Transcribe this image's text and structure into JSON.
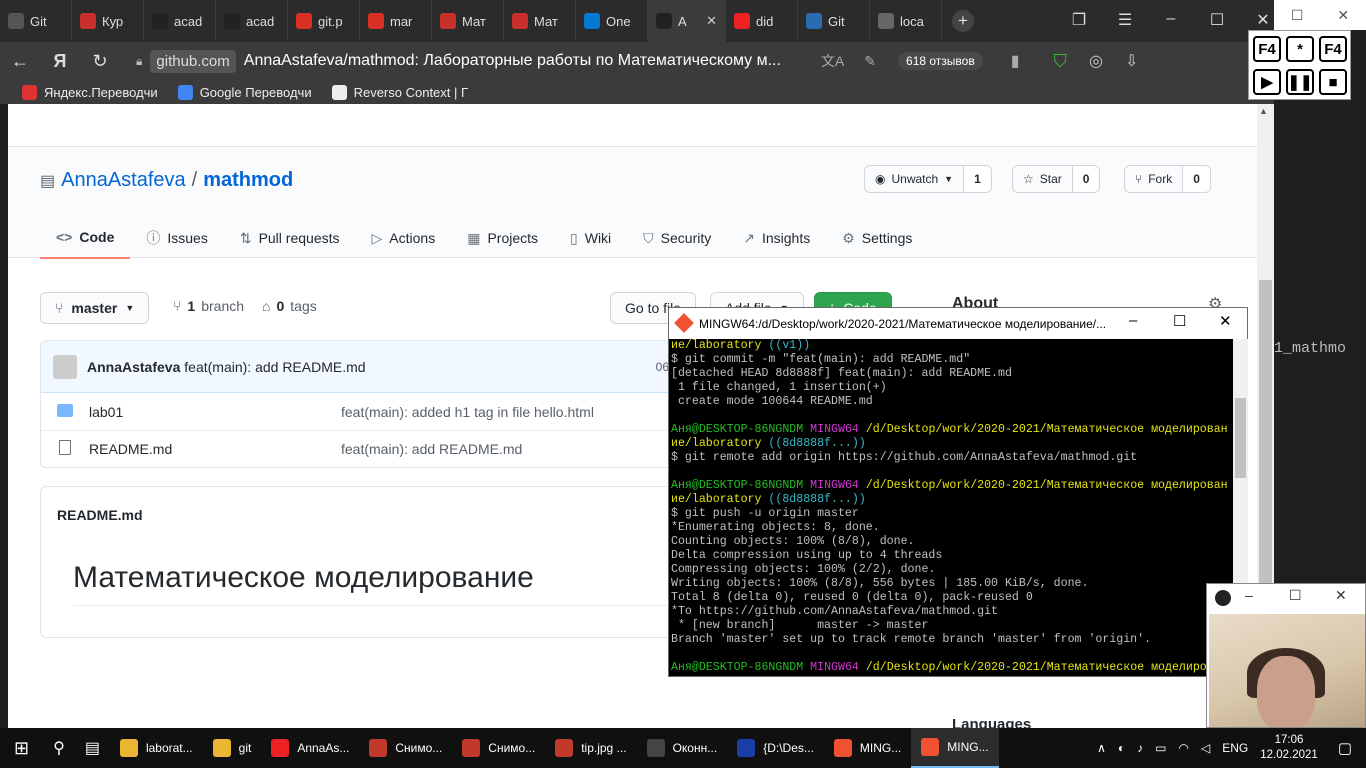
{
  "browser": {
    "tabs": [
      {
        "label": "Git",
        "icon": "bookmark-icon",
        "color": "#555"
      },
      {
        "label": "Кур",
        "icon": "course-icon",
        "color": "#c9302c"
      },
      {
        "label": "acad",
        "icon": "github-icon",
        "color": "#222"
      },
      {
        "label": "acad",
        "icon": "github-icon",
        "color": "#222"
      },
      {
        "label": "git.p",
        "icon": "pdf-icon",
        "color": "#d93025"
      },
      {
        "label": "mar",
        "icon": "pdf-icon",
        "color": "#d93025"
      },
      {
        "label": "Мат",
        "icon": "course-icon",
        "color": "#c9302c"
      },
      {
        "label": "Мат",
        "icon": "course-icon",
        "color": "#c9302c"
      },
      {
        "label": "One",
        "icon": "onedrive-icon",
        "color": "#0078d4"
      },
      {
        "label": "A",
        "icon": "github-icon",
        "color": "#222",
        "active": true
      },
      {
        "label": "did",
        "icon": "yandex-icon",
        "color": "#e22"
      },
      {
        "label": "Git",
        "icon": "git-icon",
        "color": "#2b6cb0"
      },
      {
        "label": "loca",
        "icon": "page-icon",
        "color": "#666"
      }
    ],
    "domain": "github.com",
    "page_title": "AnnaAstafeva/mathmod: Лабораторные работы по Математическому м...",
    "reviews": "618 отзывов",
    "bookmarks": [
      {
        "label": "Яндекс.Переводчи",
        "color": "#d33"
      },
      {
        "label": "Google Переводчи",
        "color": "#4285f4"
      },
      {
        "label": "Reverso Context | Г",
        "color": "#eee"
      }
    ]
  },
  "repo": {
    "owner": "AnnaAstafeva",
    "separator": "/",
    "name": "mathmod",
    "watch_label": "Unwatch",
    "watch_count": "1",
    "star_label": "Star",
    "star_count": "0",
    "fork_label": "Fork",
    "fork_count": "0",
    "nav": [
      {
        "label": "Code",
        "icon": "code-icon",
        "glyph": "<>"
      },
      {
        "label": "Issues",
        "icon": "issues-icon",
        "glyph": "ⓘ"
      },
      {
        "label": "Pull requests",
        "icon": "pull-request-icon",
        "glyph": "⇅"
      },
      {
        "label": "Actions",
        "icon": "play-icon",
        "glyph": "▷"
      },
      {
        "label": "Projects",
        "icon": "projects-icon",
        "glyph": "▦"
      },
      {
        "label": "Wiki",
        "icon": "book-icon",
        "glyph": "▯"
      },
      {
        "label": "Security",
        "icon": "shield-icon",
        "glyph": "⛉"
      },
      {
        "label": "Insights",
        "icon": "graph-icon",
        "glyph": "↗"
      },
      {
        "label": "Settings",
        "icon": "gear-icon",
        "glyph": "⚙"
      }
    ],
    "branch": "master",
    "branch_count": "1",
    "branch_word": "branch",
    "tag_count": "0",
    "tag_word": "tags",
    "goto_file": "Go to file",
    "add_file": "Add file",
    "code_label": "Code",
    "about": "About",
    "commit": {
      "author": "AnnaAstafeva",
      "message": "feat(main): add README.md",
      "hash": "06"
    },
    "files": [
      {
        "name": "lab01",
        "type": "folder",
        "message": "feat(main): added h1 tag in file hello.html"
      },
      {
        "name": "README.md",
        "type": "file",
        "message": "feat(main): add README.md"
      }
    ],
    "readme_label": "README.md",
    "readme_heading": "Математическое моделирование",
    "languages": "Languages"
  },
  "right_panel_text": "1_mathmo",
  "keys": [
    "F4",
    "*",
    "F4",
    "▶",
    "❚❚",
    "■"
  ],
  "terminal": {
    "title": "MINGW64:/d/Desktop/work/2020-2021/Математическое моделирование/...",
    "lines": [
      [
        {
          "t": "ие/laboratory ",
          "c": "c-y"
        },
        {
          "t": "((v1))",
          "c": "c-c"
        }
      ],
      [
        {
          "t": "$ git commit -m \"feat(main): add README.md\"",
          "c": ""
        }
      ],
      [
        {
          "t": "[detached HEAD 8d8888f] feat(main): add README.md",
          "c": ""
        }
      ],
      [
        {
          "t": " 1 file changed, 1 insertion(+)",
          "c": ""
        }
      ],
      [
        {
          "t": " create mode 100644 README.md",
          "c": ""
        }
      ],
      [
        {
          "t": "",
          "c": ""
        }
      ],
      [
        {
          "t": "Аня@DESKTOP-86NGNDM ",
          "c": "c-g"
        },
        {
          "t": "MINGW64 ",
          "c": "c-m"
        },
        {
          "t": "/d/Desktop/work/2020-2021/Математическое моделирован",
          "c": "c-y"
        }
      ],
      [
        {
          "t": "ие/laboratory ",
          "c": "c-y"
        },
        {
          "t": "((8d8888f...))",
          "c": "c-c"
        }
      ],
      [
        {
          "t": "$ git remote add origin https://github.com/AnnaAstafeva/mathmod.git",
          "c": ""
        }
      ],
      [
        {
          "t": "",
          "c": ""
        }
      ],
      [
        {
          "t": "Аня@DESKTOP-86NGNDM ",
          "c": "c-g"
        },
        {
          "t": "MINGW64 ",
          "c": "c-m"
        },
        {
          "t": "/d/Desktop/work/2020-2021/Математическое моделирован",
          "c": "c-y"
        }
      ],
      [
        {
          "t": "ие/laboratory ",
          "c": "c-y"
        },
        {
          "t": "((8d8888f...))",
          "c": "c-c"
        }
      ],
      [
        {
          "t": "$ git push -u origin master",
          "c": ""
        }
      ],
      [
        {
          "t": "*Enumerating objects: 8, done.",
          "c": ""
        }
      ],
      [
        {
          "t": "Counting objects: 100% (8/8), done.",
          "c": ""
        }
      ],
      [
        {
          "t": "Delta compression using up to 4 threads",
          "c": ""
        }
      ],
      [
        {
          "t": "Compressing objects: 100% (2/2), done.",
          "c": ""
        }
      ],
      [
        {
          "t": "Writing objects: 100% (8/8), 556 bytes | 185.00 KiB/s, done.",
          "c": ""
        }
      ],
      [
        {
          "t": "Total 8 (delta 0), reused 0 (delta 0), pack-reused 0",
          "c": ""
        }
      ],
      [
        {
          "t": "*To https://github.com/AnnaAstafeva/mathmod.git",
          "c": ""
        }
      ],
      [
        {
          "t": " * [new branch]      master -> master",
          "c": ""
        }
      ],
      [
        {
          "t": "Branch 'master' set up to track remote branch 'master' from 'origin'.",
          "c": ""
        }
      ],
      [
        {
          "t": "",
          "c": ""
        }
      ],
      [
        {
          "t": "Аня@DESKTOP-86NGNDM ",
          "c": "c-g"
        },
        {
          "t": "MINGW64 ",
          "c": "c-m"
        },
        {
          "t": "/d/Desktop/work/2020-2021/Математическое моделиро",
          "c": "c-y"
        }
      ]
    ]
  },
  "taskbar": {
    "items": [
      {
        "label": "laborat...",
        "icon": "folder-icon",
        "color": "#e8b632"
      },
      {
        "label": "git",
        "icon": "folder-icon",
        "color": "#e8b632"
      },
      {
        "label": "AnnaAs...",
        "icon": "yandex-browser-icon",
        "color": "#e22"
      },
      {
        "label": "Снимо...",
        "icon": "snip-icon",
        "color": "#c0392b"
      },
      {
        "label": "Снимо...",
        "icon": "snip-icon",
        "color": "#c0392b"
      },
      {
        "label": "tip.jpg ...",
        "icon": "snip-icon",
        "color": "#c0392b"
      },
      {
        "label": "Оконн...",
        "icon": "obs-icon",
        "color": "#444"
      },
      {
        "label": "{D:\\Des...",
        "icon": "far-icon",
        "color": "#1a3fa6"
      },
      {
        "label": "MING...",
        "icon": "git-bash-icon",
        "color": "#f05133"
      },
      {
        "label": "MING...",
        "icon": "git-bash-icon",
        "color": "#f05133",
        "active": true
      }
    ],
    "lang": "ENG",
    "time": "17:06",
    "date": "12.02.2021"
  }
}
